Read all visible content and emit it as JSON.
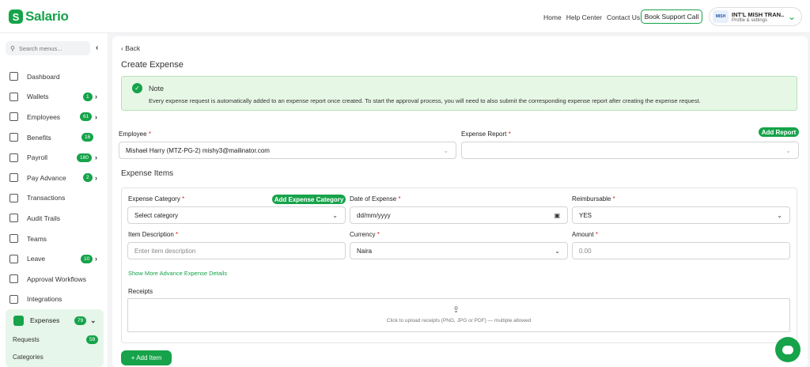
{
  "brand": {
    "name": "Salario",
    "color": "#16a34a"
  },
  "topnav": {
    "home": "Home",
    "help": "Help Center",
    "contact": "Contact Us",
    "support_button": "Book Support Call"
  },
  "profile": {
    "name": "INT'L MISH TRAN....",
    "subtitle": "Profile & settings",
    "logo_text": "MISH"
  },
  "sidebar": {
    "search_placeholder": "Search menus...",
    "items": [
      {
        "label": "Dashboard",
        "icon": "chart-icon"
      },
      {
        "label": "Wallets",
        "badge": "1",
        "arrow": "›"
      },
      {
        "label": "Employees",
        "badge": "61",
        "arrow": "›"
      },
      {
        "label": "Benefits",
        "badge": "16"
      },
      {
        "label": "Payroll",
        "badge": "180",
        "arrow": "›"
      },
      {
        "label": "Pay Advance",
        "badge": "2",
        "arrow": "›"
      },
      {
        "label": "Transactions"
      },
      {
        "label": "Audit Trails"
      },
      {
        "label": "Teams"
      },
      {
        "label": "Leave",
        "badge": "10",
        "arrow": "›"
      },
      {
        "label": "Approval Workflows"
      },
      {
        "label": "Integrations"
      }
    ],
    "expenses": {
      "label": "Expenses",
      "badge": "79",
      "requests": "Requests",
      "requests_badge": "59",
      "categories": "Categories"
    }
  },
  "page": {
    "back": "Back",
    "title": "Create Expense",
    "note_title": "Note",
    "note_text": "Every expense request is automatically added to an expense report once created. To start the approval process, you will need to also submit the corresponding expense report after creating the expense request.",
    "employee_label": "Employee",
    "employee_value": "Mishael Harry (MTZ-PG-2) mishy3@mailinator.com",
    "report_label": "Expense Report",
    "add_report": "Add Report",
    "items_title": "Expense Items",
    "category_label": "Expense Category",
    "add_category": "Add Expense Category",
    "category_placeholder": "Select category",
    "date_label": "Date of Expense",
    "date_placeholder": "dd/mm/yyyy",
    "reimbursable_label": "Reimbursable",
    "reimbursable_value": "YES",
    "desc_label": "Item Description",
    "desc_placeholder": "Enter item description",
    "currency_label": "Currency",
    "currency_value": "Naira",
    "amount_label": "Amount",
    "amount_placeholder": "0.00",
    "advanced_link": "Show More Advance Expense Details",
    "receipts_label": "Receipts",
    "upload_text": "Click to upload receipts (PNG, JPG or PDF) — multiple allowed",
    "add_item": "+ Add Item",
    "required_mark": "*"
  }
}
